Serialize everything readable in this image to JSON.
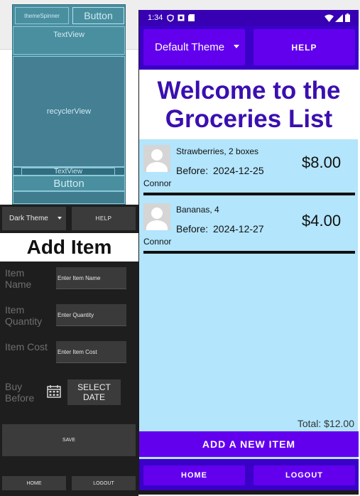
{
  "blueprint": {
    "spinner_label": "themeSpinner",
    "button_label": "Button",
    "textview_label": "TextView",
    "recycler_label": "recyclerView",
    "textview2_label": "TextView",
    "button2_label": "Button"
  },
  "add_item_screen": {
    "theme_spinner": "Dark Theme",
    "help_label": "HELP",
    "title": "Add Item",
    "fields": [
      {
        "label": "Item Name",
        "placeholder": "Enter Item Name"
      },
      {
        "label": "Item Quantity",
        "placeholder": "Enter Quantity"
      },
      {
        "label": "Item Cost",
        "placeholder": "Enter Item Cost"
      }
    ],
    "buy_before_label": "Buy Before",
    "calendar_icon": "calendar-icon",
    "select_date_label": "SELECT DATE",
    "save_label": "SAVE",
    "home_label": "HOME",
    "logout_label": "LOGOUT"
  },
  "main_screen": {
    "status": {
      "time": "1:34",
      "left_icons": [
        "shield-icon",
        "sim-icon",
        "sd-card-icon"
      ],
      "right_icons": [
        "wifi-icon",
        "signal-icon",
        "battery-icon"
      ]
    },
    "theme_spinner": "Default Theme",
    "help_label": "HELP",
    "welcome_line1": "Welcome to the",
    "welcome_line2": "Groceries List",
    "before_label": "Before:",
    "items": [
      {
        "name": "Strawberries, 2 boxes",
        "date": "2024-12-25",
        "price": "$8.00",
        "user": "Connor"
      },
      {
        "name": "Bananas, 4",
        "date": "2024-12-27",
        "price": "$4.00",
        "user": "Connor"
      }
    ],
    "total": "Total: $12.00",
    "add_label": "ADD A NEW ITEM",
    "home_label": "HOME",
    "logout_label": "LOGOUT"
  },
  "colors": {
    "primary": "#6200ee",
    "primary_dark": "#3700b3",
    "list_background": "#b3e5fc",
    "welcome_text": "#3a0fb0",
    "blueprint": "#4a8fa0",
    "dark_panel": "#1e1e1e"
  }
}
